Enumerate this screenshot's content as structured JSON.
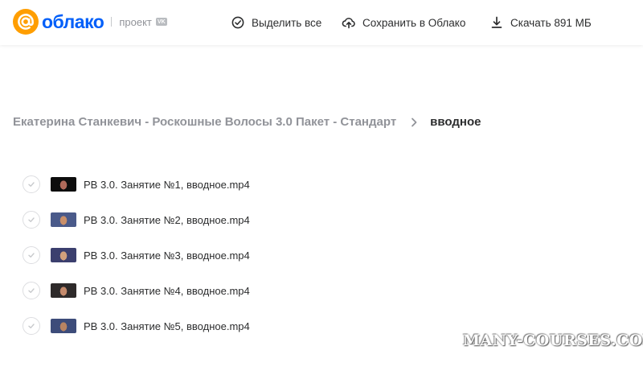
{
  "header": {
    "logo_text": "облако",
    "project_label": "проект",
    "vk_badge": "VK",
    "actions": {
      "select_all": "Выделить все",
      "save_to_cloud": "Сохранить в Облако",
      "download": "Скачать 891 МБ"
    },
    "brand_colors": {
      "orange": "#ff9e00",
      "blue": "#005ff9"
    }
  },
  "breadcrumb": {
    "parent": "Екатерина Станкевич - Роскошные Волосы 3.0 Пакет - Стандарт",
    "current": "вводное"
  },
  "files": [
    {
      "name": "РВ 3.0. Занятие №1, вводное.mp4",
      "thumb_colors": [
        "#0d0d0d",
        "#b06a5a"
      ]
    },
    {
      "name": "РВ 3.0. Занятие №2, вводное.mp4",
      "thumb_colors": [
        "#4a5a8a",
        "#c98f6a"
      ]
    },
    {
      "name": "РВ 3.0. Занятие №3, вводное.mp4",
      "thumb_colors": [
        "#3b3f6e",
        "#d1a07c"
      ]
    },
    {
      "name": "РВ 3.0. Занятие №4, вводное.mp4",
      "thumb_colors": [
        "#2e2a2a",
        "#c48a6c"
      ]
    },
    {
      "name": "РВ 3.0. Занятие №5, вводное.mp4",
      "thumb_colors": [
        "#3d4c7a",
        "#b98462"
      ]
    }
  ],
  "watermark": "MANY-COURSES.COM"
}
